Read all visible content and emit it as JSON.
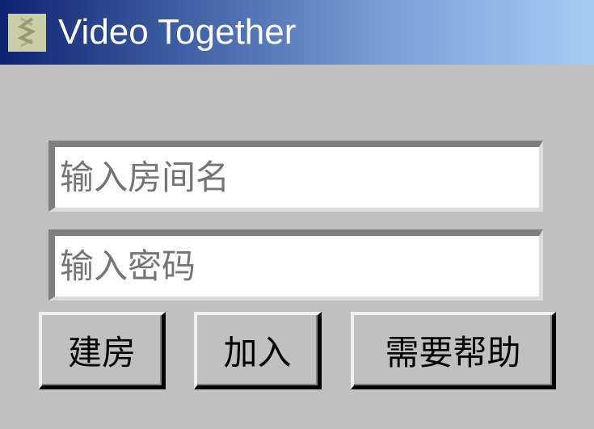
{
  "window": {
    "title": "Video Together",
    "icon": "app-logo-icon"
  },
  "form": {
    "room_name_placeholder": "输入房间名",
    "room_name_value": "",
    "password_placeholder": "输入密码",
    "password_value": ""
  },
  "buttons": {
    "create_label": "建房",
    "join_label": "加入",
    "help_label": "需要帮助"
  },
  "colors": {
    "background": "#c0c0c0",
    "title_gradient_start": "#0f2370",
    "title_gradient_end": "#a6ccf4",
    "title_text": "#ffffff",
    "placeholder_text": "#757575"
  }
}
